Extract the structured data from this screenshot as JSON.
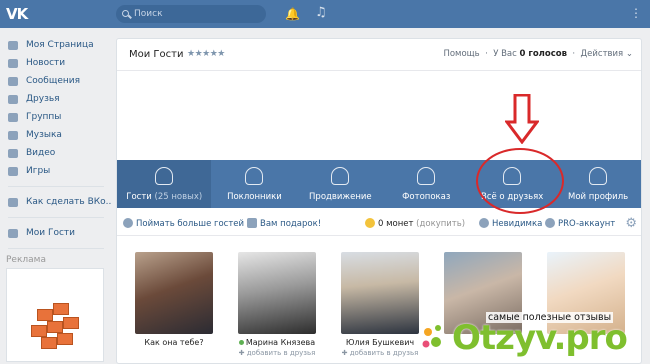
{
  "topbar": {
    "logo": "VK",
    "search_placeholder": "Поиск"
  },
  "sidebar": {
    "items": [
      {
        "label": "Моя Страница",
        "icon": "home-icon"
      },
      {
        "label": "Новости",
        "icon": "news-icon"
      },
      {
        "label": "Сообщения",
        "icon": "messages-icon"
      },
      {
        "label": "Друзья",
        "icon": "friends-icon"
      },
      {
        "label": "Группы",
        "icon": "groups-icon"
      },
      {
        "label": "Музыка",
        "icon": "music-icon"
      },
      {
        "label": "Видео",
        "icon": "video-icon"
      },
      {
        "label": "Игры",
        "icon": "games-icon"
      }
    ],
    "extra_items": [
      {
        "label": "Как сделать ВКо..",
        "icon": "app-icon"
      },
      {
        "label": "Мои Гости",
        "icon": "guests-app-icon"
      }
    ],
    "ads_title": "Реклама"
  },
  "card": {
    "title": "Мои Гости",
    "rating": "★★★★★",
    "help": "Помощь",
    "votes_prefix": "У Вас",
    "votes_value": "0 голосов",
    "actions": "Действия"
  },
  "tabs": [
    {
      "label": "Гости",
      "sub": "(25 новых)",
      "icon": "footprints-icon"
    },
    {
      "label": "Поклонники",
      "sub": "",
      "icon": "heart-person-icon"
    },
    {
      "label": "Продвижение",
      "sub": "",
      "icon": "star-person-icon"
    },
    {
      "label": "Фотопоказ",
      "sub": "",
      "icon": "photo-show-icon"
    },
    {
      "label": "Всё о друзьях",
      "sub": "",
      "icon": "friends-group-icon"
    },
    {
      "label": "Мой профиль",
      "sub": "",
      "icon": "profile-icon"
    }
  ],
  "actions": {
    "catch_more": "Поймать больше гостей",
    "gift": "Вам подарок!",
    "coins": "0 монет",
    "buy": "(докупить)",
    "invisible": "Невидимка",
    "pro": "PRO-аккаунт"
  },
  "guests": [
    {
      "name": "Как она тебе?",
      "online": false,
      "add": ""
    },
    {
      "name": "Марина Князева",
      "online": true,
      "add": "добавить в друзья"
    },
    {
      "name": "Юлия Бушкевич",
      "online": false,
      "add": "добавить в друзья"
    },
    {
      "name": "",
      "online": false,
      "add": ""
    },
    {
      "name": "",
      "online": false,
      "add": ""
    }
  ],
  "watermark": {
    "tagline": "самые полезные отзывы",
    "logo": "Otzyv.pro"
  },
  "colors": {
    "accent": "#4a76a8",
    "annotation": "#d9292a",
    "watermark": "#7fbf2e"
  }
}
